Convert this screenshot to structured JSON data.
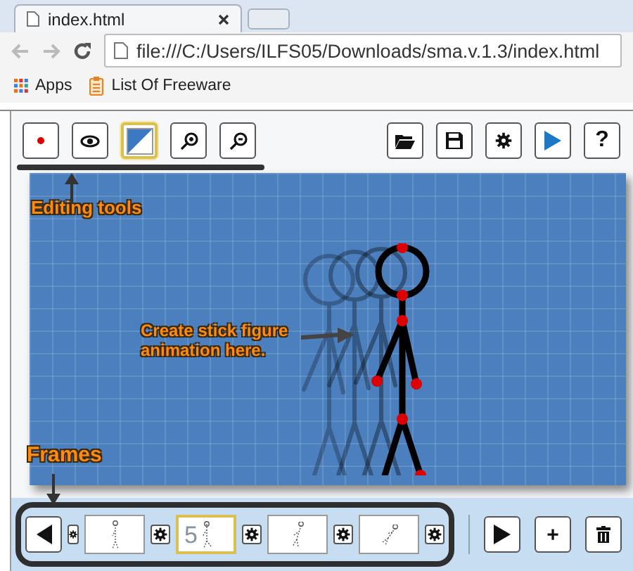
{
  "browser": {
    "tab_title": "index.html",
    "url": "file:///C:/Users/ILFS05/Downloads/sma.v.1.3/index.html",
    "bookmarks": [
      {
        "kind": "apps",
        "label": "Apps"
      },
      {
        "kind": "clipboard",
        "label": "List Of Freeware"
      }
    ]
  },
  "toolbar": {
    "left": [
      {
        "kind": "dot",
        "selected": false
      },
      {
        "kind": "eye",
        "selected": false
      },
      {
        "kind": "fill",
        "selected": true
      },
      {
        "kind": "zoom-in",
        "selected": false
      },
      {
        "kind": "zoom-out",
        "selected": false
      }
    ],
    "right": [
      {
        "kind": "folder"
      },
      {
        "kind": "save"
      },
      {
        "kind": "gear"
      },
      {
        "kind": "play"
      },
      {
        "kind": "text",
        "label": "?"
      }
    ]
  },
  "annotations": [
    {
      "kind": "tools",
      "text": "Editing tools"
    },
    {
      "kind": "canvas",
      "text": "Create stick figure animation here."
    },
    {
      "kind": "frames",
      "text": "Frames"
    }
  ],
  "frames": [
    {
      "selected": false
    },
    {
      "selected": true,
      "label": "5"
    },
    {
      "selected": false
    },
    {
      "selected": false
    }
  ],
  "controls": [
    {
      "kind": "play"
    },
    {
      "kind": "text",
      "label": "+"
    },
    {
      "kind": "trash"
    }
  ]
}
